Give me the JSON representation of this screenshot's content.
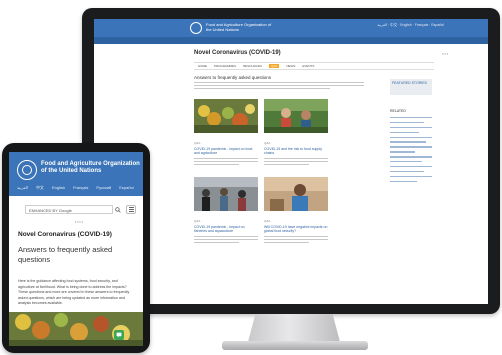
{
  "desktop": {
    "org_name": "Food and Agriculture Organization of the United Nations",
    "page_title": "Novel Coronavirus (COVID-19)",
    "section_heading": "Answers to frequently asked questions",
    "sidebar_box_title": "FEATURED STORIES",
    "sidebar_heading": "RELATED",
    "subnav": [
      {
        "label": "HOME",
        "active": false
      },
      {
        "label": "PROGRAMMES",
        "active": false
      },
      {
        "label": "RESOURCES",
        "active": false
      },
      {
        "label": "Q&A",
        "active": true
      },
      {
        "label": "NEWS",
        "active": false
      },
      {
        "label": "EVENTS",
        "active": false
      }
    ],
    "cards": [
      {
        "tag": "Q&A",
        "title": "COVID-19 pandemic - impact on food and agriculture"
      },
      {
        "tag": "Q&A",
        "title": "COVID-19 and the risk to food supply chains"
      },
      {
        "tag": "Q&A",
        "title": "COVID-19 pandemic - impact on fisheries and aquaculture"
      },
      {
        "tag": "Q&A",
        "title": "Will COVID-19 have negative impacts on global food security?"
      }
    ]
  },
  "tablet": {
    "org_name": "Food and Agriculture Organization of the United Nations",
    "nav": [
      "العربية",
      "中文",
      "English",
      "Français",
      "Русский",
      "Español"
    ],
    "search_placeholder": "ENHANCED BY Google",
    "page_title": "Novel Coronavirus (COVID-19)",
    "subtitle": "Answers to frequently asked questions",
    "body": "Here is the guidance affecting food systems, food security, and agriculture at livelihood. What is being done to address the impacts? These questions and more are covered in these answers to frequently asked questions, which are being updated as more information and analysis becomes available."
  },
  "colors": {
    "fao_blue": "#3b74b8",
    "fao_dark_blue": "#2f62a0",
    "accent_orange": "#f5a623",
    "fab_green": "#3aa65a"
  }
}
